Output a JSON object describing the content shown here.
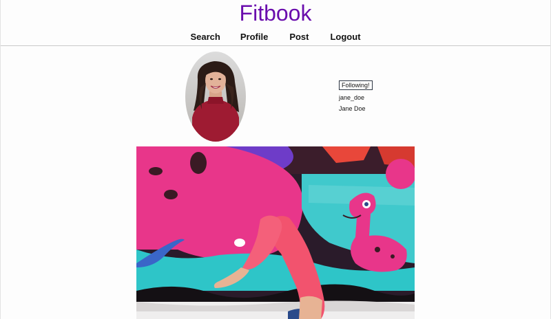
{
  "app": {
    "title": "Fitbook"
  },
  "nav": {
    "items": [
      {
        "label": "Search"
      },
      {
        "label": "Profile"
      },
      {
        "label": "Post"
      },
      {
        "label": "Logout"
      }
    ]
  },
  "profile": {
    "follow_button_label": "Following!",
    "username": "jane_doe",
    "full_name": "Jane Doe",
    "avatar_icon": "avatar-photo"
  },
  "post": {
    "image_icon": "post-photo"
  },
  "colors": {
    "brand": "#6a0dad",
    "follow_border": "#2a3340"
  }
}
